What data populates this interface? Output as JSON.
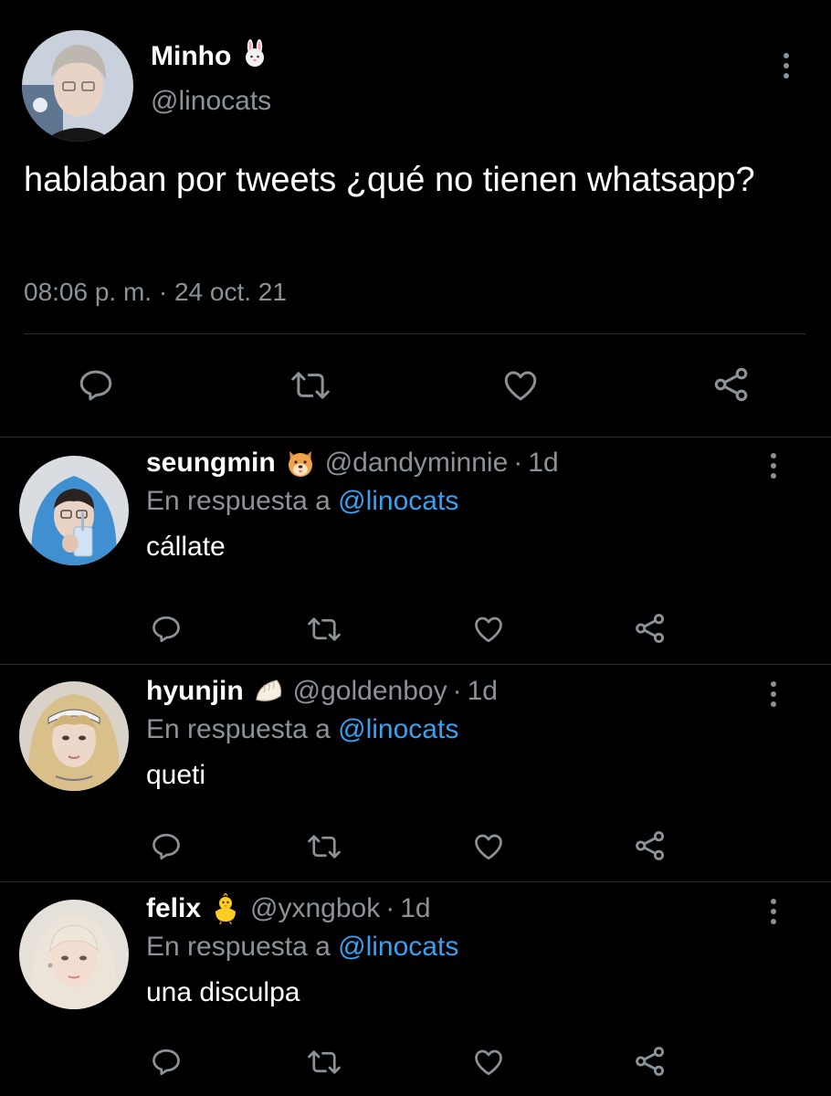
{
  "main": {
    "name": "Minho",
    "name_emoji": "rabbit-face-icon",
    "handle": "@linocats",
    "text": "hablaban por tweets ¿qué no tienen whatsapp?",
    "timestamp": "08:06 p. m. · 24 oct. 21"
  },
  "replies": [
    {
      "name": "seungmin",
      "emoji": "dog-face-icon",
      "handle": "@dandyminnie",
      "sep": "·",
      "time": "1d",
      "reply_prefix": "En respuesta a",
      "reply_mention": "@linocats",
      "text": "cállate"
    },
    {
      "name": "hyunjin",
      "emoji": "dumpling-icon",
      "handle": "@goldenboy",
      "sep": "·",
      "time": "1d",
      "reply_prefix": "En respuesta a",
      "reply_mention": "@linocats",
      "text": "queti"
    },
    {
      "name": "felix",
      "emoji": "baby-chick-icon",
      "handle": "@yxngbok",
      "sep": "·",
      "time": "1d",
      "reply_prefix": "En respuesta a",
      "reply_mention": "@linocats",
      "text": "una disculpa"
    }
  ],
  "colors": {
    "background": "#000000",
    "text_primary": "#ffffff",
    "text_secondary": "#8b9298",
    "mention": "#3aa0f0",
    "divider": "#2a2e33"
  }
}
